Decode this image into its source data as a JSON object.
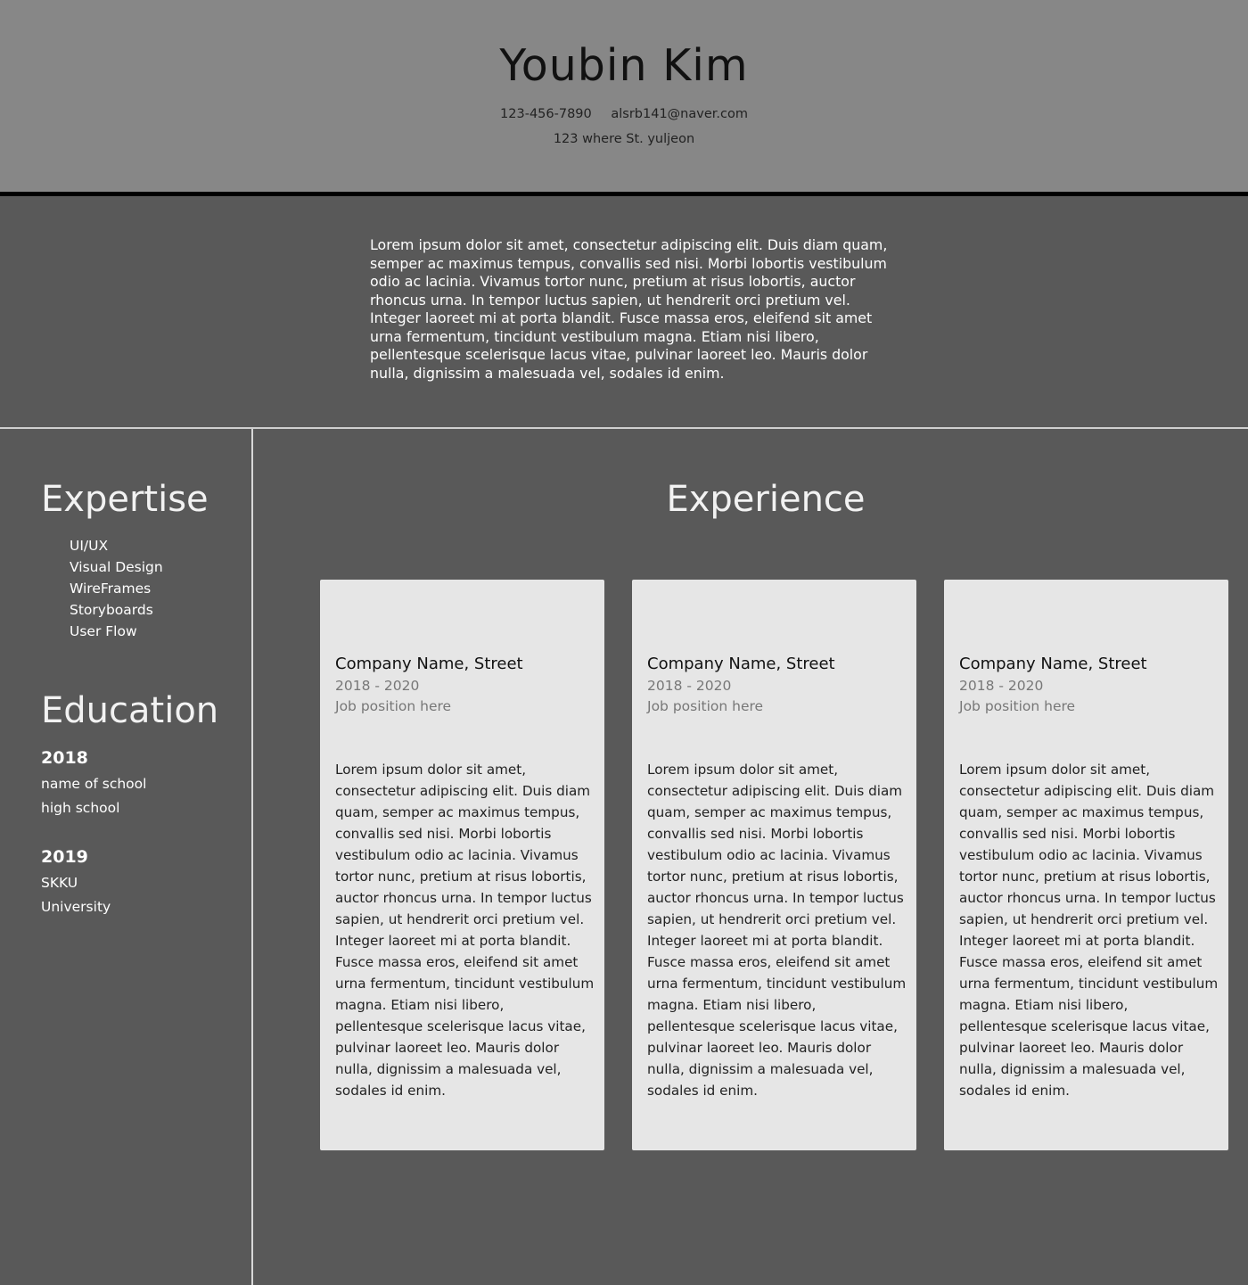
{
  "header": {
    "name": "Youbin Kim",
    "phone": "123-456-7890",
    "email": "alsrb141@naver.com",
    "address": "123 where St. yuljeon"
  },
  "summary": "Lorem ipsum dolor sit amet, consectetur adipiscing elit. Duis diam quam, semper ac maximus tempus, convallis sed nisi. Morbi lobortis vestibulum odio ac lacinia. Vivamus tortor nunc, pretium at risus lobortis, auctor rhoncus urna. In tempor luctus sapien, ut hendrerit orci pretium vel. Integer laoreet mi at porta blandit. Fusce massa eros, eleifend sit amet urna fermentum, tincidunt vestibulum magna. Etiam nisi libero, pellentesque scelerisque lacus vitae, pulvinar laoreet leo. Mauris dolor nulla, dignissim a malesuada vel, sodales id enim.",
  "expertise": {
    "title": "Expertise",
    "items": [
      "UI/UX",
      "Visual Design",
      "WireFrames",
      "Storyboards",
      "User Flow"
    ]
  },
  "education": {
    "title": "Education",
    "entries": [
      {
        "year": "2018",
        "school": "name of school",
        "type": "high school"
      },
      {
        "year": "2019",
        "school": "SKKU",
        "type": "University"
      }
    ]
  },
  "experience": {
    "title": "Experience",
    "cards": [
      {
        "company": "Company Name, Street",
        "years": "2018 - 2020",
        "position": "Job position here",
        "description": "Lorem ipsum dolor sit amet, consectetur adipiscing elit. Duis diam quam, semper ac maximus tempus, convallis sed nisi. Morbi lobortis vestibulum odio ac lacinia. Vivamus tortor nunc, pretium at risus lobortis, auctor rhoncus urna. In tempor luctus sapien, ut hendrerit orci pretium vel. Integer laoreet mi at porta blandit. Fusce massa eros, eleifend sit amet urna fermentum, tincidunt vestibulum magna. Etiam nisi libero, pellentesque scelerisque lacus vitae, pulvinar laoreet leo. Mauris dolor nulla, dignissim a malesuada vel, sodales id enim."
      },
      {
        "company": "Company Name, Street",
        "years": "2018 - 2020",
        "position": "Job position here",
        "description": "Lorem ipsum dolor sit amet, consectetur adipiscing elit. Duis diam quam, semper ac maximus tempus, convallis sed nisi. Morbi lobortis vestibulum odio ac lacinia. Vivamus tortor nunc, pretium at risus lobortis, auctor rhoncus urna. In tempor luctus sapien, ut hendrerit orci pretium vel. Integer laoreet mi at porta blandit. Fusce massa eros, eleifend sit amet urna fermentum, tincidunt vestibulum magna. Etiam nisi libero, pellentesque scelerisque lacus vitae, pulvinar laoreet leo. Mauris dolor nulla, dignissim a malesuada vel, sodales id enim."
      },
      {
        "company": "Company Name, Street",
        "years": "2018 - 2020",
        "position": "Job position here",
        "description": "Lorem ipsum dolor sit amet, consectetur adipiscing elit. Duis diam quam, semper ac maximus tempus, convallis sed nisi. Morbi lobortis vestibulum odio ac lacinia. Vivamus tortor nunc, pretium at risus lobortis, auctor rhoncus urna. In tempor luctus sapien, ut hendrerit orci pretium vel. Integer laoreet mi at porta blandit. Fusce massa eros, eleifend sit amet urna fermentum, tincidunt vestibulum magna. Etiam nisi libero, pellentesque scelerisque lacus vitae, pulvinar laoreet leo. Mauris dolor nulla, dignissim a malesuada vel, sodales id enim."
      }
    ]
  }
}
